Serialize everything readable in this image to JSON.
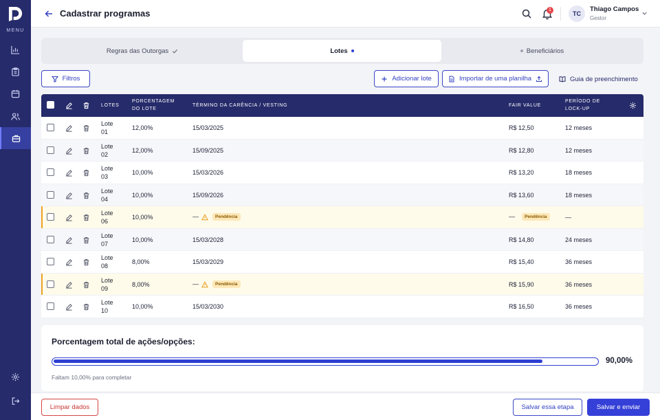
{
  "sidebar": {
    "menu_label": "MENU",
    "items": [
      {
        "icon": "bar-chart-icon",
        "active": false
      },
      {
        "icon": "clipboard-icon",
        "active": false
      },
      {
        "icon": "calendar-icon",
        "active": false
      },
      {
        "icon": "users-icon",
        "active": false
      },
      {
        "icon": "briefcase-icon",
        "active": true
      }
    ],
    "bottom_items": [
      {
        "icon": "settings-icon"
      },
      {
        "icon": "logout-icon"
      }
    ]
  },
  "header": {
    "title": "Cadastrar programas",
    "notifications_count": "1",
    "user": {
      "initials": "TC",
      "name": "Thiago Campos",
      "role": "Gestor"
    }
  },
  "tabs": [
    {
      "label": "Regras das Outorgas",
      "state": "done"
    },
    {
      "label": "Lotes",
      "state": "active"
    },
    {
      "label": "Beneficiários",
      "state": "pending"
    }
  ],
  "toolbar": {
    "filters_label": "Filtros",
    "add_lot_label": "Adicionar lote",
    "import_label": "Importar de uma planilha",
    "guide_label": "Guia de preenchimento"
  },
  "table": {
    "columns": {
      "lotes": "LOTES",
      "percentage": "PORCENTAGEM DO LOTE",
      "vesting": "TÉRMINO DA CARÊNCIA / VESTING",
      "fair_value": "FAIR VALUE",
      "lockup": "PERÍODO DE LOCK-UP"
    },
    "pending_label": "Pendência",
    "dash": "—",
    "rows": [
      {
        "lote": "Lote 01",
        "percentage": "12,00%",
        "vesting": "15/03/2025",
        "fair_value": "R$ 12,50",
        "lockup": "12 meses",
        "vesting_pending": false,
        "fair_pending": false
      },
      {
        "lote": "Lote 02",
        "percentage": "12,00%",
        "vesting": "15/09/2025",
        "fair_value": "R$ 12,80",
        "lockup": "12 meses",
        "vesting_pending": false,
        "fair_pending": false
      },
      {
        "lote": "Lote 03",
        "percentage": "10,00%",
        "vesting": "15/03/2026",
        "fair_value": "R$ 13,20",
        "lockup": "18 meses",
        "vesting_pending": false,
        "fair_pending": false
      },
      {
        "lote": "Lote 04",
        "percentage": "10,00%",
        "vesting": "15/09/2026",
        "fair_value": "R$ 13,60",
        "lockup": "18 meses",
        "vesting_pending": false,
        "fair_pending": false
      },
      {
        "lote": "Lote 06",
        "percentage": "10,00%",
        "vesting": "",
        "fair_value": "",
        "lockup": "—",
        "vesting_pending": true,
        "fair_pending": true
      },
      {
        "lote": "Lote 07",
        "percentage": "10,00%",
        "vesting": "15/03/2028",
        "fair_value": "R$ 14,80",
        "lockup": "24 meses",
        "vesting_pending": false,
        "fair_pending": false
      },
      {
        "lote": "Lote 08",
        "percentage": "8,00%",
        "vesting": "15/03/2029",
        "fair_value": "R$ 15,40",
        "lockup": "36 meses",
        "vesting_pending": false,
        "fair_pending": false
      },
      {
        "lote": "Lote 09",
        "percentage": "8,00%",
        "vesting": "",
        "fair_value": "R$ 15,90",
        "lockup": "36 meses",
        "vesting_pending": true,
        "fair_pending": false
      },
      {
        "lote": "Lote 10",
        "percentage": "10,00%",
        "vesting": "15/03/2030",
        "fair_value": "R$ 16,50",
        "lockup": "36 meses",
        "vesting_pending": false,
        "fair_pending": false
      }
    ]
  },
  "summary": {
    "title": "Porcentagem total de ações/opções:",
    "value": "90,00%",
    "progress": 0.9,
    "caption": "Faltam 10,00% para completar"
  },
  "footer": {
    "clear_label": "Limpar dados",
    "save_step_label": "Salvar essa etapa",
    "submit_label": "Salvar e enviar"
  },
  "colors": {
    "primary": "#3540d8",
    "navy": "#262b6b",
    "danger": "#d64545",
    "warning": "#f0a020"
  }
}
